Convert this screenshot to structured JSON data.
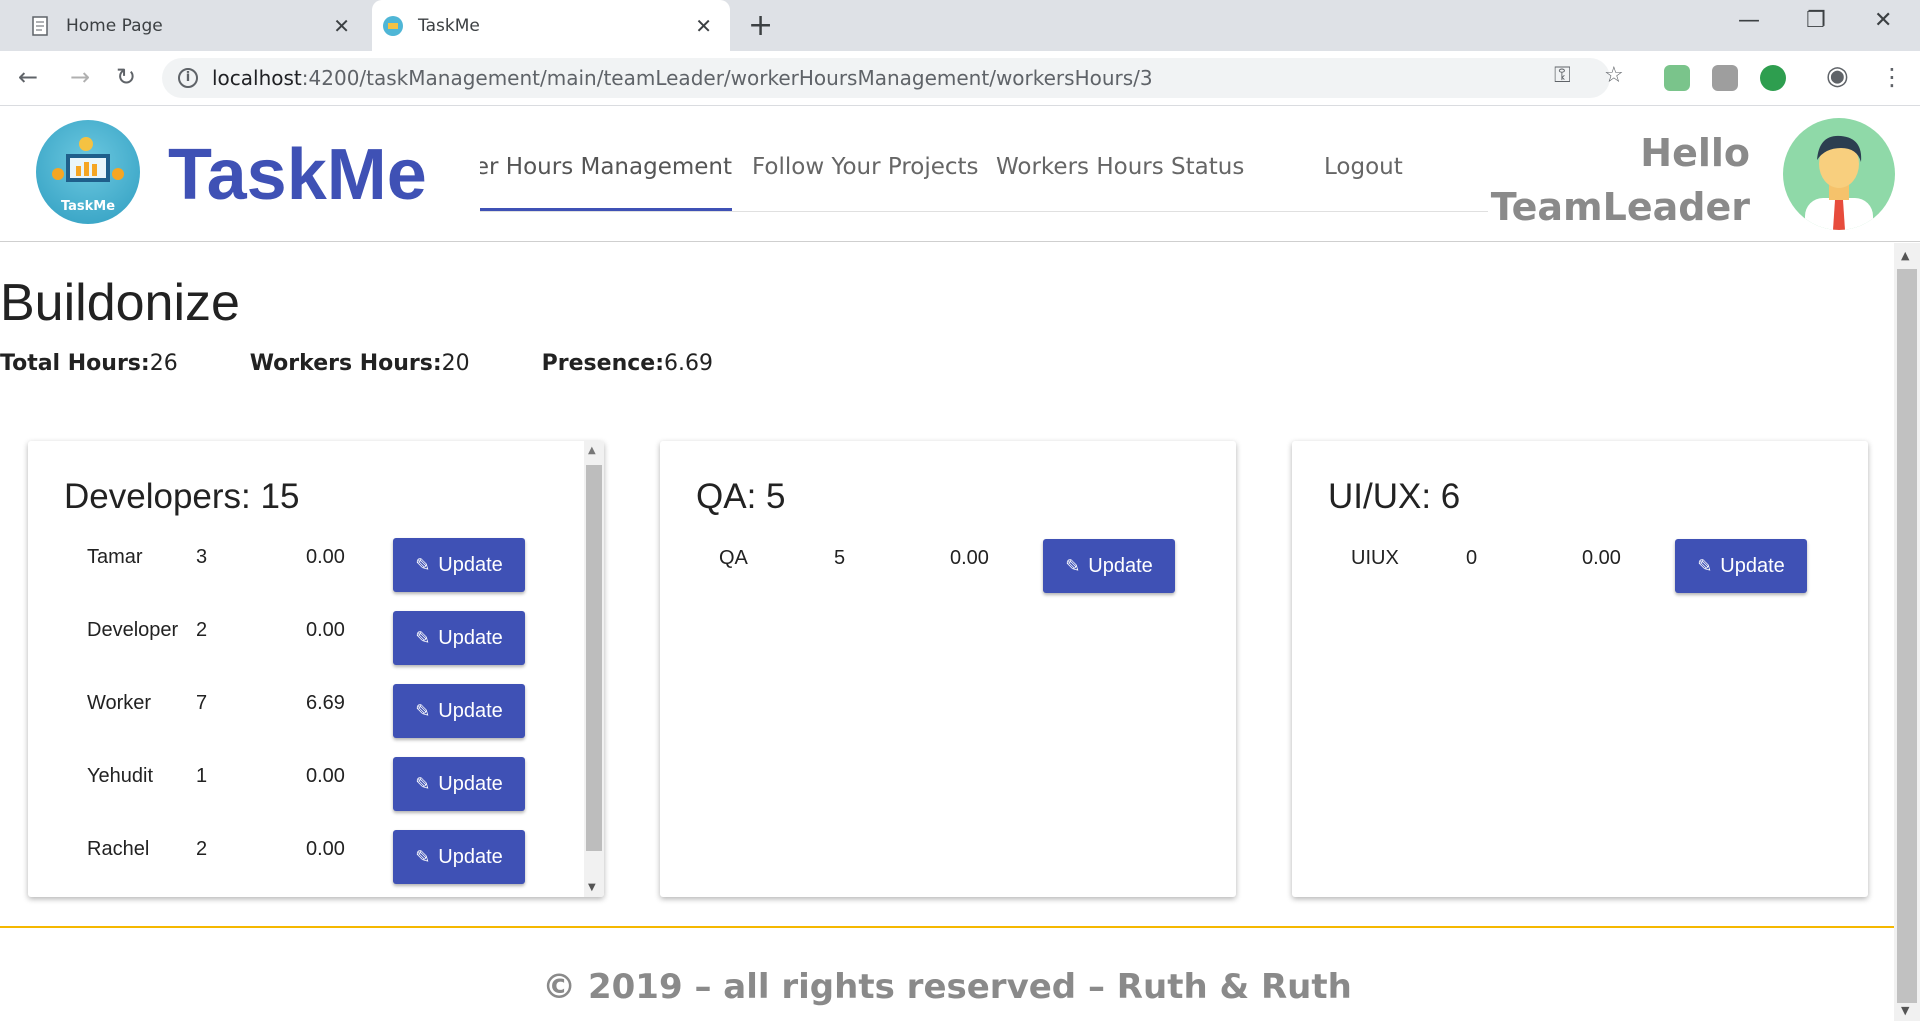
{
  "browser": {
    "tabs": [
      {
        "label": "Home Page",
        "icon": "document-icon"
      },
      {
        "label": "TaskMe",
        "icon": "taskme-favicon"
      }
    ],
    "close_glyph": "✕",
    "new_tab_glyph": "+",
    "url_host": "localhost",
    "url_rest": ":4200/taskManagement/main/teamLeader/workerHoursManagement/workersHours/3"
  },
  "app": {
    "brand": "TaskMe",
    "logo_text": "TaskMe",
    "nav": [
      {
        "label": "Worker Hours Management",
        "active": true
      },
      {
        "label": "Follow Your Projects"
      },
      {
        "label": "Workers Hours Status"
      },
      {
        "label": "Logout"
      }
    ],
    "greeting_line1": "Hello",
    "greeting_line2": "TeamLeader",
    "accent_color": "#3f51b5"
  },
  "project": {
    "name": "Buildonize",
    "total_hours_label": "Total Hours:",
    "total_hours": "26",
    "workers_hours_label": "Workers Hours:",
    "workers_hours": "20",
    "presence_label": "Presence:",
    "presence": "6.69"
  },
  "cards": [
    {
      "title": "Developers: 15",
      "rows": [
        {
          "name": "Tamar",
          "hours": "3",
          "presence": "0.00"
        },
        {
          "name": "Developer",
          "hours": "2",
          "presence": "0.00"
        },
        {
          "name": "Worker",
          "hours": "7",
          "presence": "6.69"
        },
        {
          "name": "Yehudit",
          "hours": "1",
          "presence": "0.00"
        },
        {
          "name": "Rachel",
          "hours": "2",
          "presence": "0.00"
        }
      ]
    },
    {
      "title": "QA: 5",
      "rows": [
        {
          "name": "QA",
          "hours": "5",
          "presence": "0.00"
        }
      ]
    },
    {
      "title": "UI/UX: 6",
      "rows": [
        {
          "name": "UIUX",
          "hours": "0",
          "presence": "0.00"
        }
      ]
    }
  ],
  "update_label": "Update",
  "footer": "© 2019 – all rights reserved – Ruth & Ruth"
}
